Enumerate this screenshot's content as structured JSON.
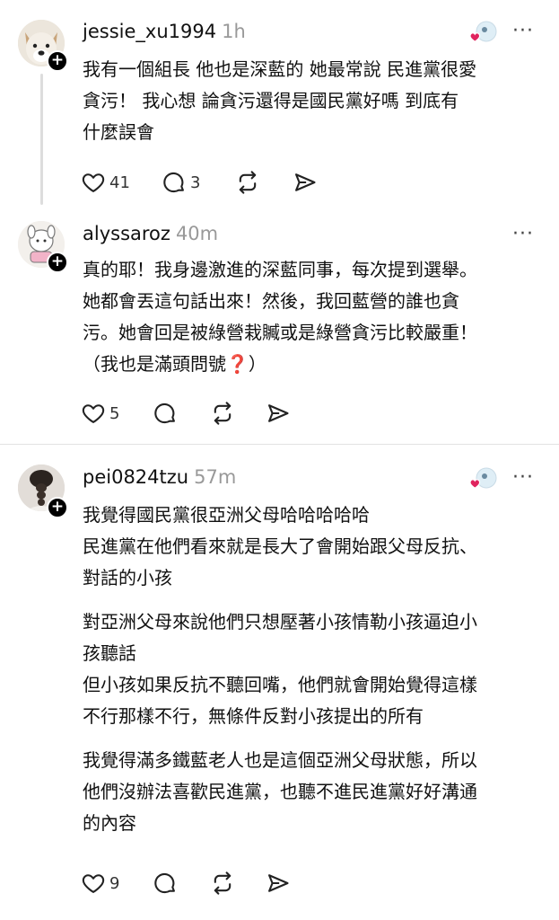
{
  "posts": [
    {
      "username": "jessie_xu1994",
      "time": "1h",
      "paragraphs": [
        "我有一個組長 他也是深藍的 她最常說 民進黨很愛\n貪污！ 我心想 論貪污還得是國民黨好嗎  到底有\n什麼誤會"
      ],
      "likes": "41",
      "replies": "3",
      "reposts": "",
      "avatar": "dog-avatar",
      "has_heart_badge": true
    },
    {
      "username": "alyssaroz",
      "time": "40m",
      "paragraphs": [
        "真的耶！我身邊激進的深藍同事，每次提到選舉。\n她都會丟這句話出來！然後，我回藍營的誰也貪\n污。她會回是被綠營栽贓或是綠營貪污比較嚴重！\n（我也是滿頭問號❓）"
      ],
      "likes": "5",
      "replies": "",
      "reposts": "",
      "avatar": "cartoon-avatar",
      "has_heart_badge": false
    },
    {
      "username": "pei0824tzu",
      "time": "57m",
      "paragraphs": [
        "我覺得國民黨很亞洲父母哈哈哈哈哈\n民進黨在他們看來就是長大了會開始跟父母反抗、\n對話的小孩",
        "對亞洲父母來說他們只想壓著小孩情勒小孩逼迫小\n孩聽話\n但小孩如果反抗不聽回嘴，他們就會開始覺得這樣\n不行那樣不行，無條件反對小孩提出的所有",
        "我覺得滿多鐵藍老人也是這個亞洲父母狀態，所以\n他們沒辦法喜歡民進黨，也聽不進民進黨好好溝通\n的內容"
      ],
      "likes": "9",
      "replies": "",
      "reposts": "",
      "avatar": "braid-avatar",
      "has_heart_badge": true
    }
  ],
  "ui": {
    "follow_plus": "+",
    "more_dots": "···"
  },
  "colors": {
    "text": "#111111",
    "muted": "#999999",
    "heart_badge": "#e0245e"
  }
}
